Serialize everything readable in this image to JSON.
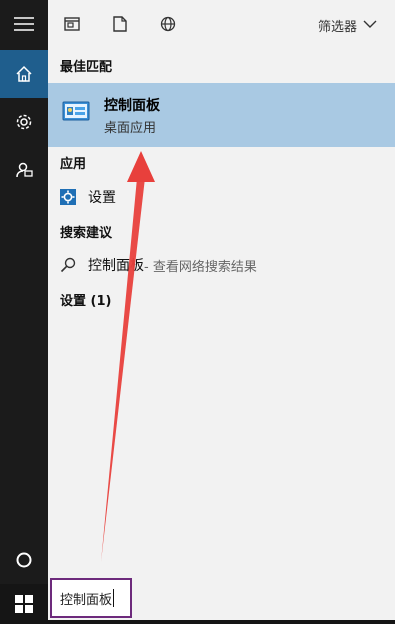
{
  "topbar": {
    "icons": [
      "document-icon",
      "page-icon",
      "globe-icon"
    ],
    "filter_label": "筛选器"
  },
  "sections": {
    "best_match": "最佳匹配",
    "apps": "应用",
    "suggestions": "搜索建议",
    "settings": "设置 (1)"
  },
  "best_result": {
    "title": "控制面板",
    "subtitle": "桌面应用"
  },
  "apps": [
    {
      "label": "设置",
      "icon": "settings-icon"
    }
  ],
  "suggestion": {
    "query": "控制面板",
    "hint": " - 查看网络搜索结果"
  },
  "search": {
    "value": "控制面板"
  },
  "rail": {
    "items": [
      "hamburger-icon",
      "home-icon",
      "gear-icon",
      "feedback-icon",
      "cortana-icon"
    ]
  },
  "colors": {
    "rail_bg": "#1b1b1b",
    "rail_active": "#1f5e8d",
    "best_match_bg": "#a9c9e3",
    "arrow": "#e8403c",
    "search_border": "#6d2a7c"
  }
}
